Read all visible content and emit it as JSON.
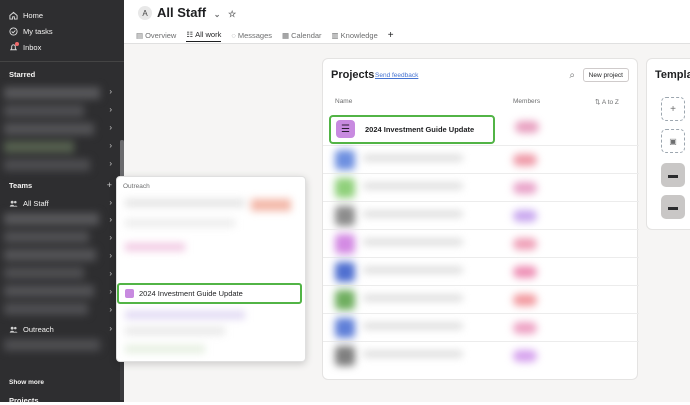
{
  "sidebar": {
    "nav": [
      {
        "label": "Home",
        "icon": "home-icon"
      },
      {
        "label": "My tasks",
        "icon": "check-circle-icon"
      },
      {
        "label": "Inbox",
        "icon": "bell-icon"
      }
    ],
    "starred_title": "Starred",
    "teams_title": "Teams",
    "teams_add": "+",
    "all_staff_label": "All Staff",
    "outreach_label": "Outreach",
    "show_more": "Show more",
    "projects_title": "Projects"
  },
  "header": {
    "avatar_letter": "A",
    "title": "All Staff",
    "tabs": [
      {
        "label": "Overview",
        "icon": "doc-icon"
      },
      {
        "label": "All work",
        "icon": "list-icon"
      },
      {
        "label": "Messages",
        "icon": "message-icon"
      },
      {
        "label": "Calendar",
        "icon": "calendar-icon"
      },
      {
        "label": "Knowledge",
        "icon": "book-icon"
      }
    ],
    "add_tab": "+"
  },
  "projects": {
    "title": "Projects",
    "feedback_link": "Send feedback",
    "new_project": "New project",
    "col_name": "Name",
    "col_members": "Members",
    "sort_label": "A to Z",
    "highlight_project": "2024 Investment Guide Update"
  },
  "templates": {
    "title": "Templa"
  },
  "dropdown": {
    "title": "Outreach",
    "highlight_item": "2024 Investment Guide Update"
  },
  "colors": {
    "sidebar_bg": "#2e2e30",
    "highlight_border": "#52b446",
    "project_purple": "#c88ae0",
    "link_blue": "#4573d2"
  }
}
